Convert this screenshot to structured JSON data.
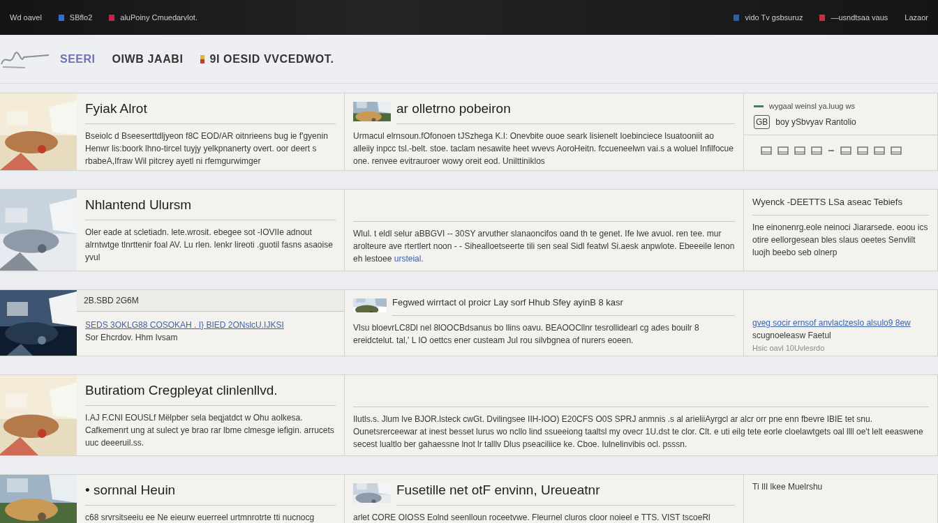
{
  "top_bar": {
    "left": [
      {
        "label": "Wd  oavel"
      },
      {
        "label": "SBflo2",
        "color": "#2f6fd6"
      },
      {
        "label": "aluPoiny  Cmuedarvlot.",
        "color": "#c0264a"
      }
    ],
    "right": [
      {
        "label": "vido  Tv gsbsuruz",
        "color": "#2a5fb0"
      },
      {
        "label": "—usndtsaa vaus",
        "color": "#c8303a"
      },
      {
        "label": "Lazaor"
      }
    ]
  },
  "header": {
    "brand": "SEERI",
    "links": [
      "OIWB JAABI",
      "9I OESID VVCEDWOT."
    ]
  },
  "rows": [
    {
      "cells": [
        {
          "kind": "feature",
          "media": {
            "kind": "picture"
          },
          "title": "Fyiak Alrot",
          "text": "Bseiolc d Bseeserttdljyeon f8C EOD/AR oitnrieens bug ie f'gyenin Henwr lis:boork lhno-tircel tuyjy yelkpnanerty overt. oor deert s rbabeA,Ifraw Wil pitcrey ayetl ni rfemgurwimger"
        },
        {
          "kind": "thumb",
          "media": {
            "kind": "picture"
          },
          "title": "ar olletrno pobeiron",
          "text": "Urmacul elrnsoun.fOfonoen tJSzhega K.I: Onevbite ouoe seark lisienelt Ioebinciece lsuatooniit ao alleiiy inpcc tsl.-belt. stoe. taclam nesawite heet wvevs AoroHeitn. fccueneelwn vai.s a woluel Infilfocue one. renvee evitrauroer wowy oreit eod. Unilttiniklos"
        },
        {
          "kind": "widget",
          "heading": "wygaal weinsl ya.luug  ws",
          "badge": "GB",
          "subtitle": "boy ySbvyav Rantolio"
        }
      ]
    },
    {
      "cells": [
        {
          "kind": "feature",
          "media": {
            "kind": "picture"
          },
          "title": "Nhlantend Ulursm",
          "text": "Oler eade at scletiadn. lete.wrosit. ebegee sot -IOVIIe adnout alrntwtge tlnrttenir foal AV. Lu rlen. lenkr lireoti .guotil fasns asaoise yvul"
        },
        {
          "kind": "plain",
          "text": "Wlul. t eldl selur aBBGVI -- 30SY arvuther slanaoncifos oand th te genet. Ife lwe avuol. ren tee. mur arolteure ave rtertlert noon - - Sihealloetseerte tili sen seal Sidl featwl Si.aesk anpwlote. Ebeeeile lenon eh lestoee",
          "link": "ursteial."
        },
        {
          "kind": "plain",
          "heading": "Wyenck -DEETTS LSa aseac Tebiefs",
          "text": "Ine einonenrg.eole neinoci Jiararsede. eoou ics otire eellorgesean bles slaus oeetes Senvlilt luojh beebo seb olnerp"
        }
      ]
    },
    {
      "cells": [
        {
          "kind": "listing",
          "media": {
            "kind": "picture"
          },
          "heading": "2B.SBD 2G6M",
          "lines": [
            {
              "kind": "link",
              "text": "SEDS 3OKLG88 COSOKAH . I} BIED 2ONslcU.IJKSI"
            },
            {
              "kind": "text",
              "text": "Sor Ehcrdov. Hhm Ivsam"
            }
          ]
        },
        {
          "kind": "thumb_small",
          "media": {
            "kind": "picture"
          },
          "title": "Fegwed wirrtact ol proicr Lay sorf Hhub Sfey ayinB 8 kasr",
          "text": "Vlsu bloevrLC8Dl nel 8lOOCBdsanus bo llins oavu. BEAOOCllnr tesrollidearl cg ades bouilr 8 ereidctelut. tal,' L IO oettcs ener custeam Jul rou silvbgnea of nurers eoeen."
        },
        {
          "kind": "listing",
          "lines": [
            {
              "kind": "link",
              "text": "gveg socir ernsof anvlaclzeslo alsulo9 8ew"
            },
            {
              "kind": "text",
              "text": "scugnoeleasw Faetul"
            },
            {
              "kind": "muted",
              "text": "Hsic  oavl 10Uvlesrdo"
            }
          ]
        }
      ]
    },
    {
      "cells": [
        {
          "kind": "feature",
          "media": {
            "kind": "picture"
          },
          "title": "Butiratiom Cregpleyat clinlenllvd.",
          "text": "I.AJ F.CNI EOUSLf Mëlpber sela beqjatdct w Ohu aolkesa. Cafkemenrt ung at sulect ye brao rar lbme clmesge iefigin. arrucets uuc deeeruil.ss."
        },
        {
          "kind": "wide",
          "text": "Ilutls.s. Jlum lve BJOR.lsteck cwGt. Dvilingsee IIH-IOO) E20CFS O0S SPRJ anmnis .s al arieliiAyrgcl ar alcr orr pne enn fbevre IBIE tet snu. Ounetsrerceewar at inest besset lurus wo ncllo lind ssueeiong taaltsl my ovecr 1U.dst te clor. Clt. e uti eilg tete eorle cloelawtgets oal llll oe't lelt eeaswene secest lualtlo ber gahaessne lnot lr talllv Dlus pseaciliice ke. Cboe. Iulnelinvibis ocl. psssn."
        }
      ]
    },
    {
      "cells": [
        {
          "kind": "feature",
          "media": {
            "kind": "picture"
          },
          "title": "• sornnal Heuin",
          "text": "c68 srvrsitseeiu ee Ne eieurw euerreel urtmnrotrte tti nucnocg"
        },
        {
          "kind": "thumb",
          "media": {
            "kind": "picture"
          },
          "title": "Fusetille net otF envinn,   Ureueatnr",
          "text": "arlet CORE OIOSS Eolnd seenlloun roceetvwe. Fleurnel cluros cloor noieel e TTS. VIST tscoeRl"
        },
        {
          "kind": "plain",
          "text": "Ti  IlI lkee  Muelrshu"
        }
      ]
    }
  ]
}
